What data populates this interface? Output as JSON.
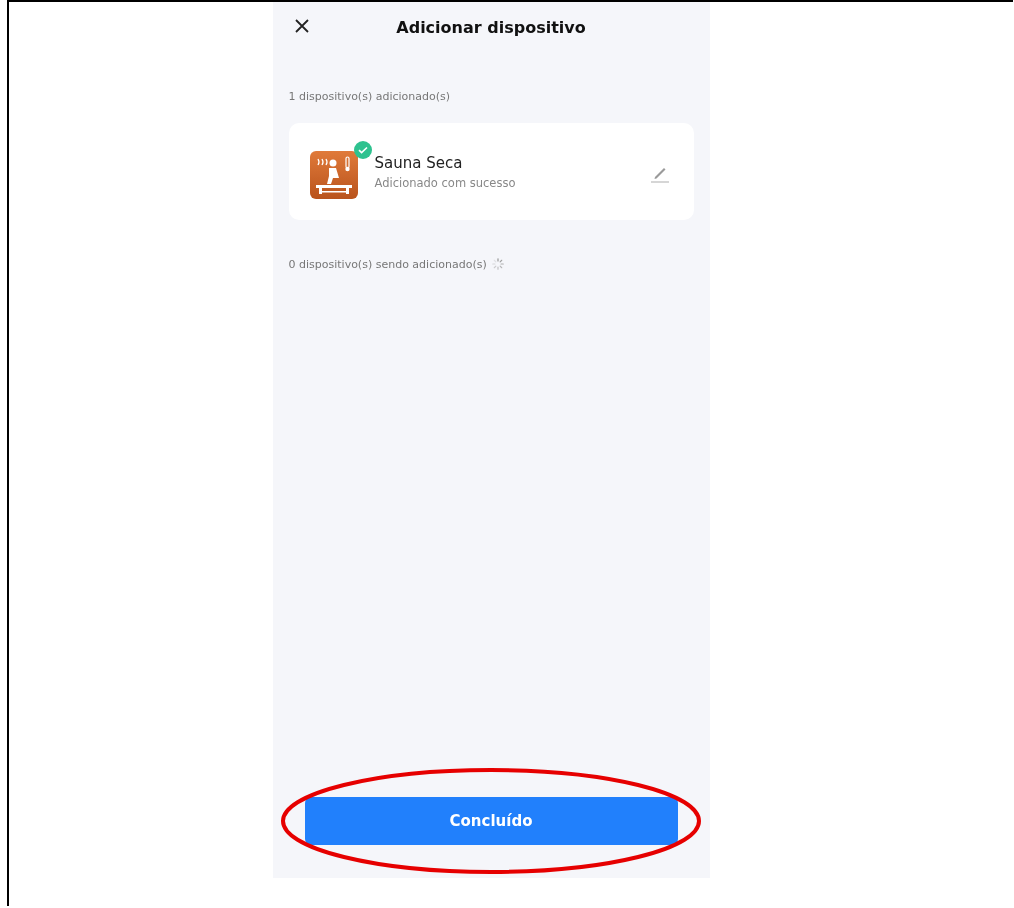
{
  "header": {
    "title": "Adicionar dispositivo"
  },
  "added_label": "1 dispositivo(s) adicionado(s)",
  "devices": [
    {
      "name": "Sauna Seca",
      "status": "Adicionado com sucesso",
      "added": true
    }
  ],
  "pending_label": "0 dispositivo(s) sendo adicionado(s)",
  "pending_loading": true,
  "done_button": {
    "label": "Concluído",
    "highlighted": true
  }
}
